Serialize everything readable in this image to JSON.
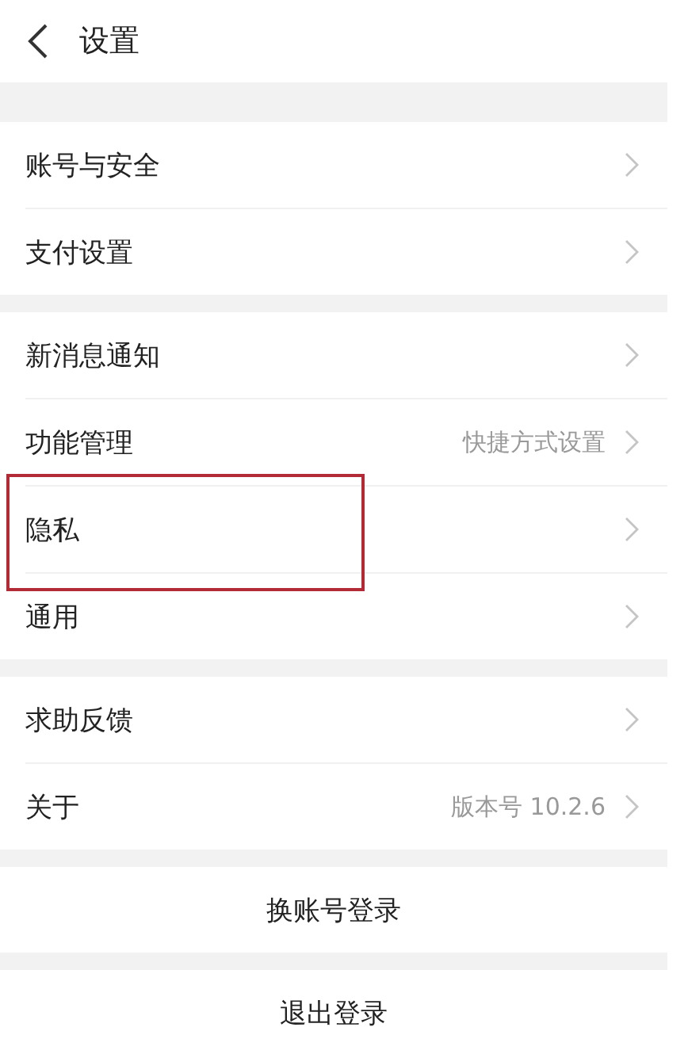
{
  "header": {
    "title": "设置"
  },
  "groups": [
    {
      "items": [
        {
          "label": "账号与安全",
          "highlighted": false
        },
        {
          "label": "支付设置",
          "highlighted": false
        }
      ]
    },
    {
      "items": [
        {
          "label": "新消息通知",
          "highlighted": false
        },
        {
          "label": "功能管理",
          "value": "快捷方式设置",
          "highlighted": false
        },
        {
          "label": "隐私",
          "highlighted": true
        },
        {
          "label": "通用",
          "highlighted": false
        }
      ]
    },
    {
      "items": [
        {
          "label": "求助反馈",
          "highlighted": false
        },
        {
          "label": "关于",
          "value": "版本号 10.2.6",
          "highlighted": false
        }
      ]
    }
  ],
  "buttons": [
    "换账号登录",
    "退出登录"
  ]
}
